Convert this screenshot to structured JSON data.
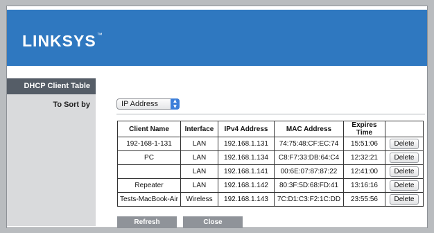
{
  "brand": {
    "name": "LINKSYS",
    "tm": "™"
  },
  "sidebar": {
    "heading": "DHCP Client Table",
    "sort_label": "To Sort by"
  },
  "sort": {
    "selected": "IP Address",
    "arrow": "⇳"
  },
  "table": {
    "headers": [
      "Client Name",
      "Interface",
      "IPv4 Address",
      "MAC Address",
      "Expires Time"
    ],
    "rows": [
      {
        "name": "192-168-1-131",
        "interface": "LAN",
        "ip": "192.168.1.131",
        "mac": "74:75:48:CF:EC:74",
        "expires": "15:51:06",
        "action": "Delete"
      },
      {
        "name": "PC",
        "interface": "LAN",
        "ip": "192.168.1.134",
        "mac": "C8:F7:33:DB:64:C4",
        "expires": "12:32:21",
        "action": "Delete"
      },
      {
        "name": "",
        "interface": "LAN",
        "ip": "192.168.1.141",
        "mac": "00:6E:07:87:87:22",
        "expires": "12:41:00",
        "action": "Delete"
      },
      {
        "name": "Repeater",
        "interface": "LAN",
        "ip": "192.168.1.142",
        "mac": "80:3F:5D:68:FD:41",
        "expires": "13:16:16",
        "action": "Delete"
      },
      {
        "name": "Tests-MacBook-Air",
        "interface": "Wireless",
        "ip": "192.168.1.143",
        "mac": "7C:D1:C3:F2:1C:DD",
        "expires": "23:55:56",
        "action": "Delete"
      }
    ]
  },
  "buttons": {
    "refresh": "Refresh",
    "close": "Close"
  },
  "colors": {
    "banner": "#2f78c0",
    "sidebar_head": "#555d67",
    "sidebar": "#d9dadc",
    "button": "#8f9399"
  }
}
